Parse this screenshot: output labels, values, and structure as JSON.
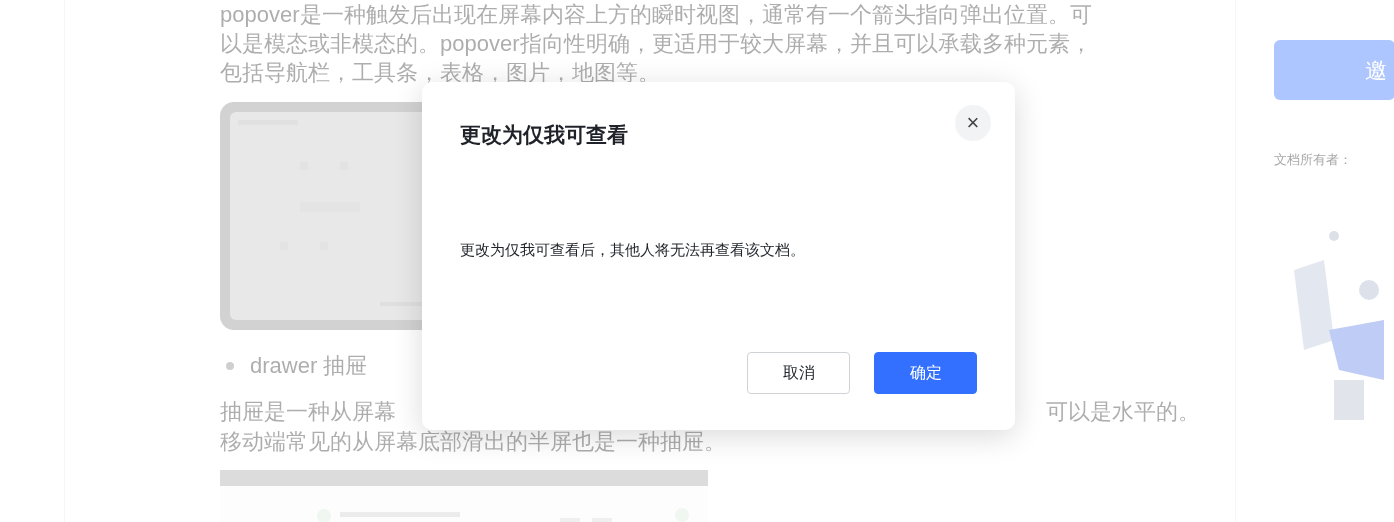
{
  "document": {
    "intro_lines": [
      "popover是一种触发后出现在屏幕内容上方的瞬时视图，通常有一个箭头指向弹出位置。可",
      "以是模态或非模态的。popover指向性明确，更适用于较大屏幕，并且可以承载多种元素，",
      "包括导航栏，工具条，表格，图片，地图等。"
    ],
    "bullet": "drawer 抽屉",
    "drawer_line_left": "抽屉是一种从屏幕",
    "drawer_line_right": "可以是水平的。",
    "drawer_line_2": "移动端常见的从屏幕底部滑出的半屏也是一种抽屉。"
  },
  "sidebar": {
    "invite_button": "邀",
    "owner_label": "文档所有者："
  },
  "dialog": {
    "title": "更改为仅我可查看",
    "close": "×",
    "message": "更改为仅我可查看后，其他人将无法再查看该文档。",
    "buttons": [
      {
        "label": "取消",
        "kind": "secondary"
      },
      {
        "label": "确定",
        "kind": "primary"
      }
    ]
  }
}
